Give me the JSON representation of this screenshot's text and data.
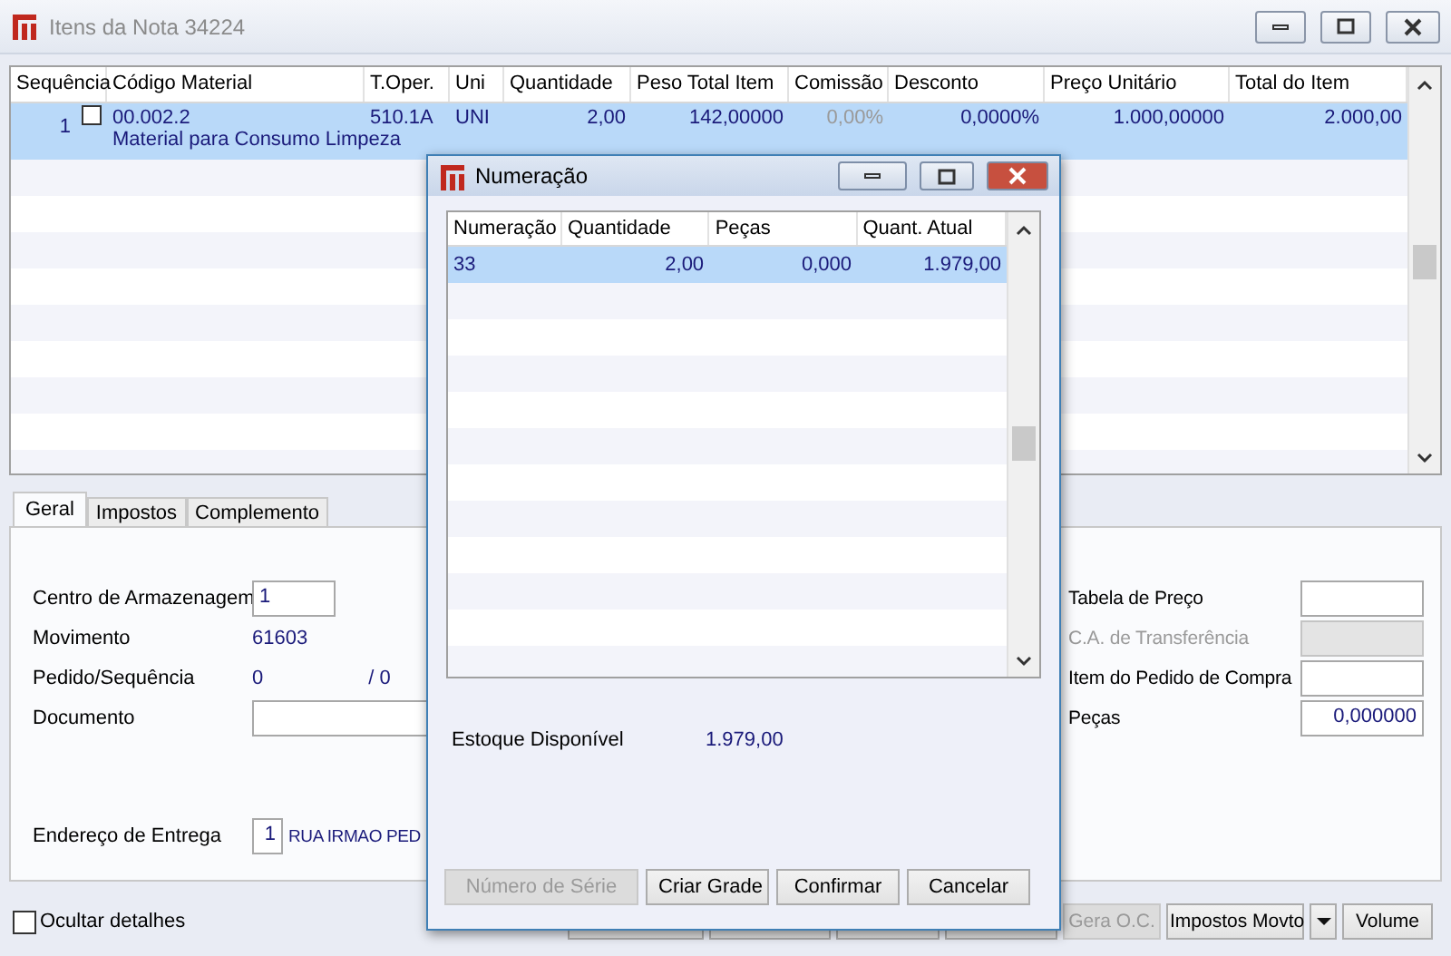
{
  "window": {
    "title": "Itens da Nota 34224"
  },
  "items_table": {
    "columns": [
      {
        "label": "Sequência",
        "disabled": false
      },
      {
        "label": "Código Material",
        "disabled": false
      },
      {
        "label": "T.Oper.",
        "disabled": false
      },
      {
        "label": "Uni",
        "disabled": false
      },
      {
        "label": "Quantidade",
        "disabled": false
      },
      {
        "label": "Peso Total Item",
        "disabled": false
      },
      {
        "label": "Comissão",
        "disabled": true
      },
      {
        "label": "Desconto",
        "disabled": false
      },
      {
        "label": "Preço Unitário",
        "disabled": false
      },
      {
        "label": "Total do Item",
        "disabled": false
      }
    ],
    "rows": [
      {
        "selected": true,
        "checked": false,
        "cells": [
          "1",
          "00.002.2",
          "510.1A",
          "UNI",
          "2,00",
          "142,00000",
          "0,00%",
          "0,0000%",
          "1.000,00000",
          "2.000,00"
        ],
        "description": "Material para Consumo Limpeza"
      }
    ]
  },
  "tabs": [
    {
      "label": "Geral",
      "selected": true
    },
    {
      "label": "Impostos",
      "selected": false
    },
    {
      "label": "Complemento",
      "selected": false
    }
  ],
  "left_fields": [
    {
      "kind": "input",
      "label": "Centro de Armazenagem",
      "value": "1"
    },
    {
      "kind": "value",
      "label": "Movimento",
      "value": "61603"
    },
    {
      "kind": "pair",
      "label": "Pedido/Sequência",
      "value": "0",
      "value2": "/ 0"
    },
    {
      "kind": "wide_input",
      "label": "Documento"
    },
    {
      "kind": "address",
      "label": "Endereço de Entrega",
      "value": "1",
      "text": "RUA IRMAO PED"
    }
  ],
  "right_fields": [
    {
      "label": "Tabela de Preço",
      "disabled": false
    },
    {
      "label": "C.A. de Transferência",
      "disabled": true
    },
    {
      "label": "Item do Pedido de Compra",
      "disabled": false
    },
    {
      "label": "Peças",
      "disabled": false,
      "value": "0,000000"
    }
  ],
  "hide_details": {
    "label": "Ocultar detalhes",
    "checked": false
  },
  "bottom_buttons": [
    {
      "kind": "obscured"
    },
    {
      "kind": "obscured"
    },
    {
      "kind": "obscured"
    },
    {
      "kind": "obscured"
    },
    {
      "kind": "button",
      "label": "Gera O.C.",
      "disabled": true
    },
    {
      "kind": "button",
      "label": "Impostos Movto",
      "disabled": false
    },
    {
      "kind": "dropdown",
      "disabled": false
    },
    {
      "kind": "button",
      "label": "Volume",
      "disabled": false
    }
  ],
  "dialog": {
    "title": "Numeração",
    "table": {
      "columns": [
        "Numeração",
        "Quantidade",
        "Peças",
        "Quant. Atual"
      ],
      "rows": [
        {
          "selected": true,
          "cells": [
            "33",
            "2,00",
            "0,000",
            "1.979,00"
          ]
        }
      ]
    },
    "stock": {
      "label": "Estoque Disponível",
      "value": "1.979,00"
    },
    "buttons": [
      {
        "label": "Número de Série",
        "disabled": true
      },
      {
        "label": "Criar Grade",
        "disabled": false
      },
      {
        "label": "Confirmar",
        "disabled": false
      },
      {
        "label": "Cancelar",
        "disabled": false
      }
    ]
  }
}
